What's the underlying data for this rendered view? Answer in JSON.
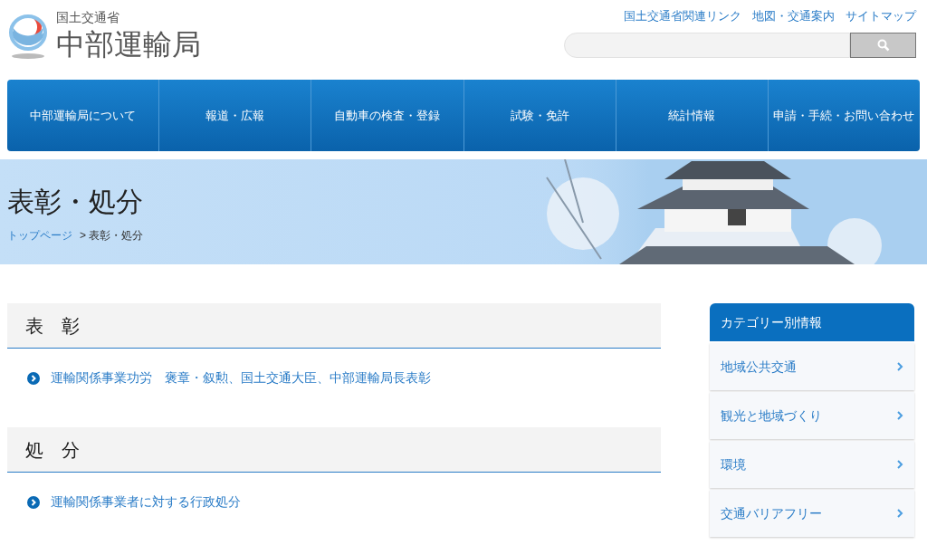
{
  "header": {
    "logo_ministry": "国土交通省",
    "logo_bureau": "中部運輸局",
    "links": [
      "国土交通省関連リンク",
      "地図・交通案内",
      "サイトマップ"
    ]
  },
  "nav": [
    "中部運輸局について",
    "報道・広報",
    "自動車の検査・登録",
    "試験・免許",
    "統計情報",
    "申請・手続・お問い合わせ"
  ],
  "banner": {
    "title": "表彰・処分",
    "breadcrumb": [
      {
        "label": "トップページ",
        "kind": "link"
      },
      {
        "label": "> 表彰・処分",
        "kind": "current"
      }
    ]
  },
  "sections": [
    {
      "heading": "表　彰",
      "links": [
        "運輸関係事業功労　褒章・叙勲、国土交通大臣、中部運輸局長表彰"
      ]
    },
    {
      "heading": "処　分",
      "links": [
        "運輸関係事業者に対する行政処分"
      ]
    }
  ],
  "sidebar": {
    "title": "カテゴリー別情報",
    "items": [
      "地域公共交通",
      "観光と地域づくり",
      "環境",
      "交通バリアフリー"
    ]
  }
}
